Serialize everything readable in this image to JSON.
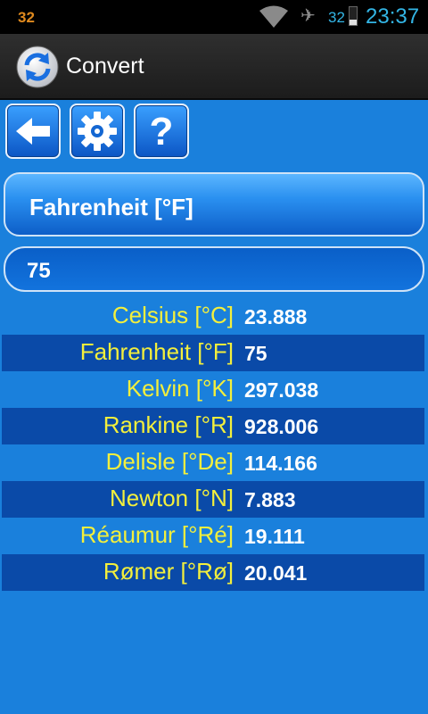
{
  "status_bar": {
    "notification_count": "32",
    "battery_percent": "32",
    "battery_level": 0.32,
    "time": "23:37",
    "icons": [
      "wifi-icon",
      "airplane-icon",
      "battery-icon"
    ]
  },
  "action_bar": {
    "title": "Convert",
    "icon": "convert-refresh-icon"
  },
  "toolbar": {
    "buttons": [
      {
        "name": "back",
        "icon": "arrow-left-icon"
      },
      {
        "name": "settings",
        "icon": "gear-icon"
      },
      {
        "name": "help",
        "icon": "question-icon",
        "label": "?"
      }
    ]
  },
  "unit_selector": {
    "selected": "Fahrenheit [°F]"
  },
  "input": {
    "value": "75"
  },
  "results": [
    {
      "unit": "Celsius [°C]",
      "value": "23.888"
    },
    {
      "unit": "Fahrenheit [°F]",
      "value": "75"
    },
    {
      "unit": "Kelvin [°K]",
      "value": "297.038"
    },
    {
      "unit": "Rankine [°R]",
      "value": "928.006"
    },
    {
      "unit": "Delisle [°De]",
      "value": "114.166"
    },
    {
      "unit": "Newton [°N]",
      "value": "7.883"
    },
    {
      "unit": "Réaumur [°Ré]",
      "value": "19.111"
    },
    {
      "unit": "Rømer [°Rø]",
      "value": "20.041"
    }
  ],
  "colors": {
    "background": "#1a80dc",
    "unit_label": "#f3ef3c",
    "value_text": "#ffffff",
    "alt_row": "#0a4aa8"
  }
}
